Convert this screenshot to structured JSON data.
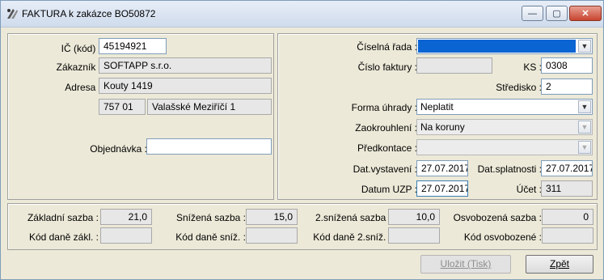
{
  "window": {
    "title": "FAKTURA k zakázce BO50872",
    "controls": {
      "minimize": "—",
      "maximize": "▢",
      "close": "✕"
    }
  },
  "customer": {
    "ic_label": "IČ (kód) :",
    "ic_value": "45194921",
    "customer_label": "Zákazník :",
    "customer_value": "SOFTAPP s.r.o.",
    "address_label": "Adresa :",
    "address_value": "Kouty 1419",
    "zip_value": "757 01",
    "city_value": "Valašské Meziříčí 1",
    "order_label": "Objednávka :",
    "order_value": ""
  },
  "invoice": {
    "series_label": "Číselná řada :",
    "series_value": "",
    "number_label": "Číslo faktury :",
    "number_value": "",
    "ks_label": "KS :",
    "ks_value": "0308",
    "center_label": "Středisko :",
    "center_value": "2",
    "payment_label": "Forma úhrady :",
    "payment_value": "Neplatit",
    "rounding_label": "Zaokrouhlení :",
    "rounding_value": "Na koruny",
    "precontract_label": "Předkontace :",
    "precontract_value": "",
    "issue_label": "Dat.vystavení :",
    "issue_value": "27.07.2017",
    "due_label": "Dat.splatnosti :",
    "due_value": "27.07.2017",
    "uzp_label": "Datum UZP :",
    "uzp_value": "27.07.2017",
    "account_label": "Účet :",
    "account_value": "311"
  },
  "vat": {
    "base_label": "Základní sazba :",
    "base_value": "21,0",
    "reduced_label": "Snížená sazba :",
    "reduced_value": "15,0",
    "reduced2_label": "2.snížená sazba :",
    "reduced2_value": "10,0",
    "exempt_label": "Osvobozená sazba :",
    "exempt_value": "0",
    "code_base_label": "Kód daně zákl. :",
    "code_base_value": "",
    "code_reduced_label": "Kód daně sníž. :",
    "code_reduced_value": "",
    "code_reduced2_label": "Kód daně 2.sníž. :",
    "code_reduced2_value": "",
    "code_exempt_label": "Kód osvobozené :",
    "code_exempt_value": ""
  },
  "buttons": {
    "save_label": "Uložit (Tisk)",
    "back_label": "Zpět"
  },
  "colors": {
    "selection": "#0a64d2",
    "window_bg": "#ece9d8"
  }
}
